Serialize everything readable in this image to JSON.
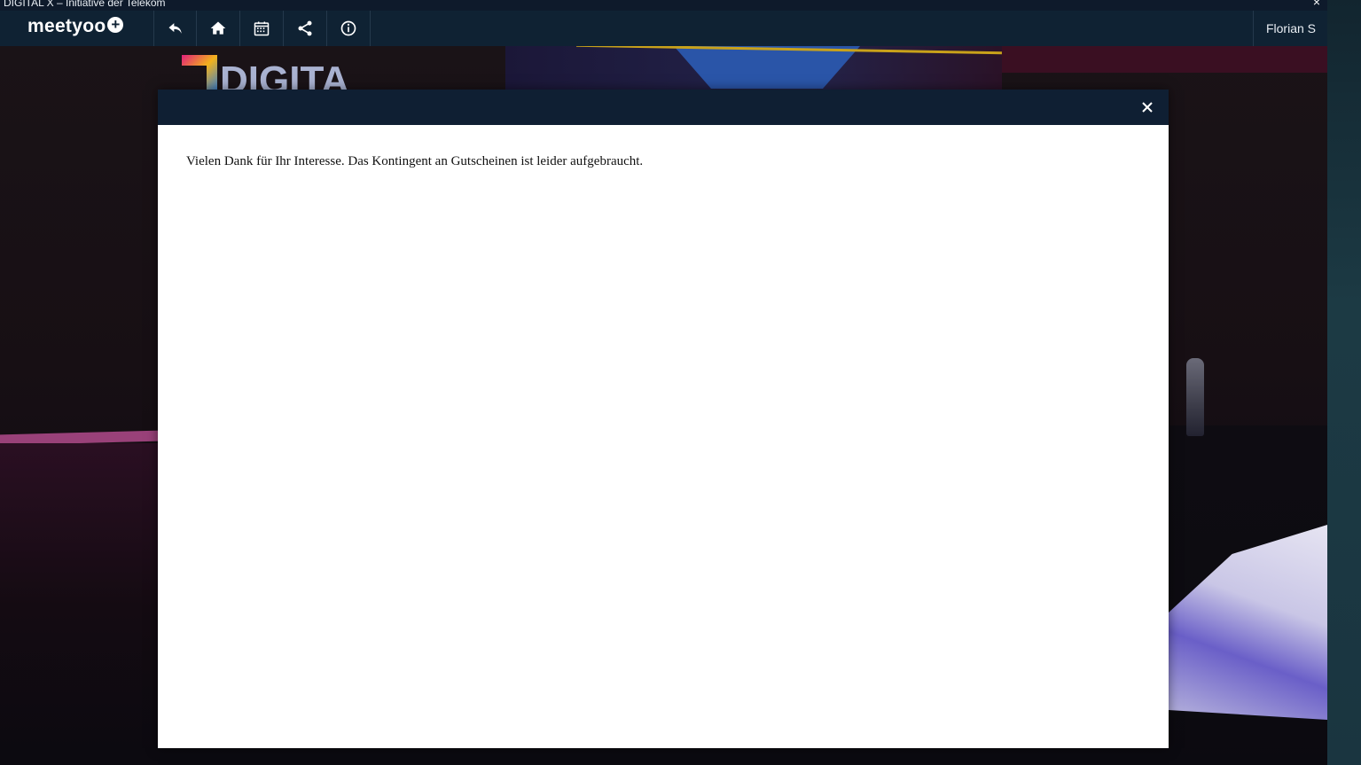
{
  "window": {
    "title": "DIGITAL X – Initiative der Telekom",
    "close_glyph": "×"
  },
  "navbar": {
    "logo_text": "meetyoo",
    "logo_plus": "+",
    "buttons": [
      {
        "name": "back",
        "icon": "reply-arrow-icon"
      },
      {
        "name": "home",
        "icon": "home-icon"
      },
      {
        "name": "agenda",
        "icon": "calendar-icon"
      },
      {
        "name": "share",
        "icon": "share-icon"
      },
      {
        "name": "info",
        "icon": "info-icon"
      }
    ],
    "user_name": "Florian S"
  },
  "modal": {
    "message": "Vielen Dank für Ihr Interesse. Das Kontingent an Gutscheinen ist leider aufgebraucht.",
    "close_icon": "close-icon"
  },
  "stage": {
    "logo_text": "DIGITA"
  },
  "colors": {
    "navbar": "#0f2233",
    "modal_header": "#0f1f33",
    "modal_body": "#ffffff",
    "text": "#111111"
  }
}
